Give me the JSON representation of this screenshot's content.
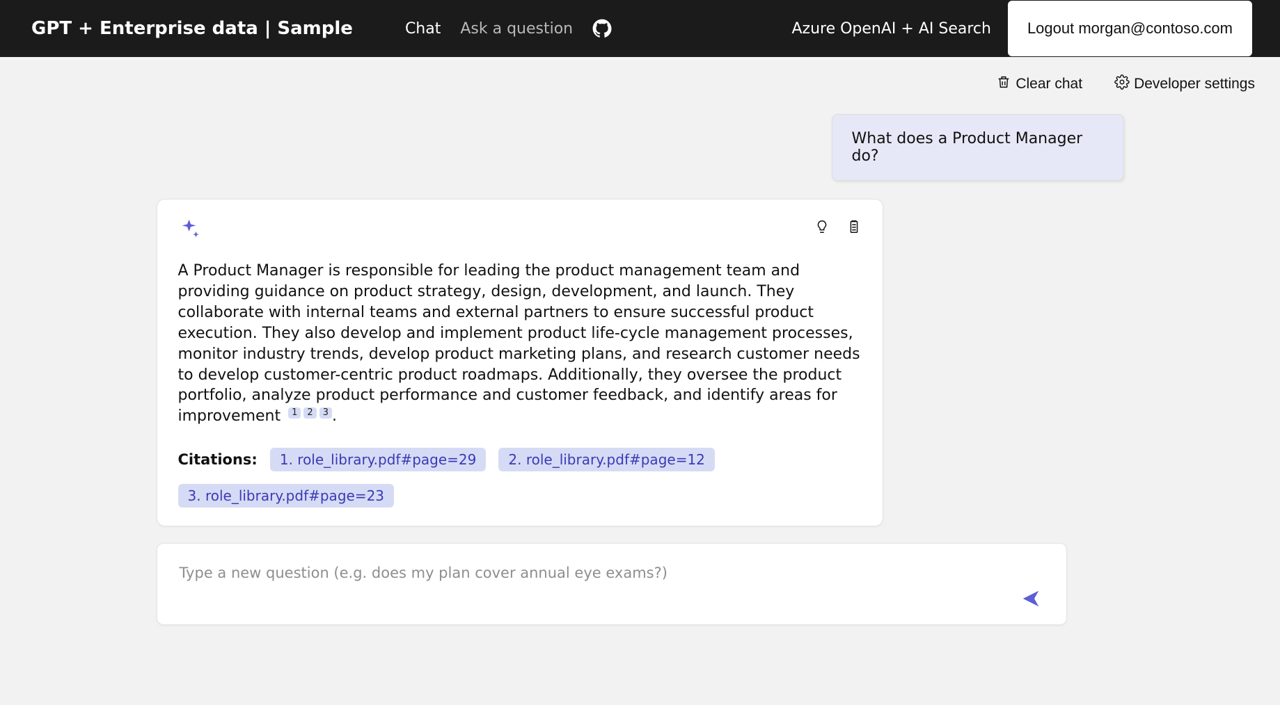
{
  "header": {
    "title": "GPT + Enterprise data | Sample",
    "nav": {
      "chat": "Chat",
      "ask": "Ask a question"
    },
    "subtitle": "Azure OpenAI + AI Search",
    "logout": "Logout morgan@contoso.com"
  },
  "toolbar": {
    "clear_chat": "Clear chat",
    "dev_settings": "Developer settings"
  },
  "conversation": {
    "user_message": "What does a Product Manager do?",
    "answer_text": "A Product Manager is responsible for leading the product management team and providing guidance on product strategy, design, development, and launch. They collaborate with internal teams and external partners to ensure successful product execution. They also develop and implement product life-cycle management processes, monitor industry trends, develop product marketing plans, and research customer needs to develop customer-centric product roadmaps. Additionally, they oversee the product portfolio, analyze product performance and customer feedback, and identify areas for improvement ",
    "answer_trailing": ".",
    "sup_refs": {
      "r1": "1",
      "r2": "2",
      "r3": "3"
    },
    "citations_label": "Citations:",
    "citations": {
      "c1": "1. role_library.pdf#page=29",
      "c2": "2. role_library.pdf#page=12",
      "c3": "3. role_library.pdf#page=23"
    }
  },
  "input": {
    "placeholder": "Type a new question (e.g. does my plan cover annual eye exams?)"
  }
}
